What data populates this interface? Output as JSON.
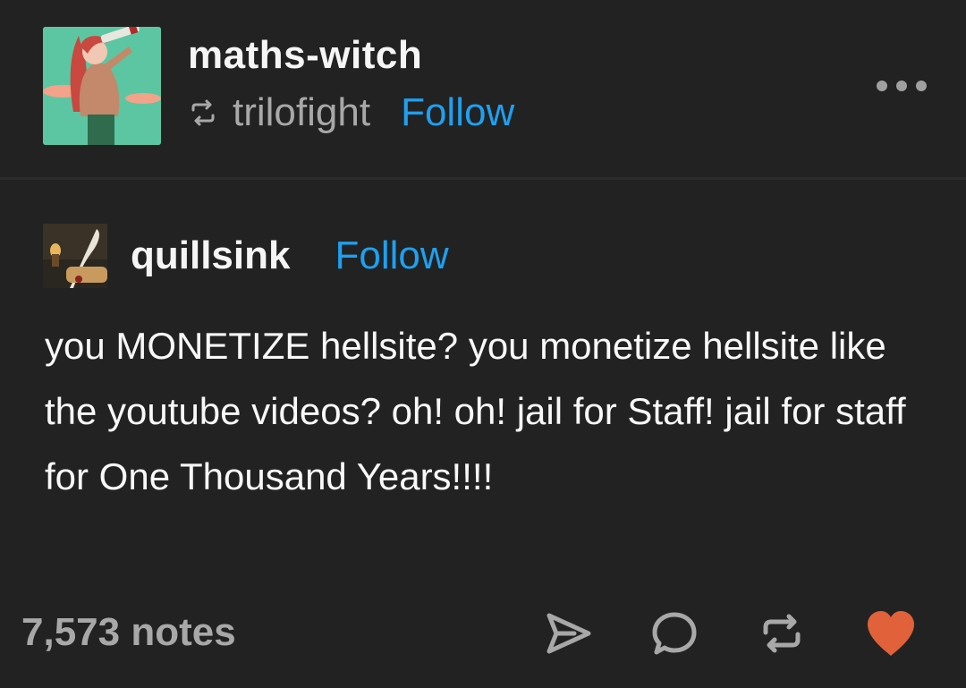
{
  "header": {
    "username": "maths-witch",
    "reblogged_from": "trilofight",
    "follow_label": "Follow",
    "avatar_icon": "illustrated-avatar-icon"
  },
  "quote": {
    "username": "quillsink",
    "follow_label": "Follow",
    "avatar_icon": "quill-avatar-icon",
    "text": "you MONETIZE hellsite? you monetize hellsite like the youtube videos? oh! oh! jail for Staff! jail for staff for One Thousand Years!!!!"
  },
  "footer": {
    "notes": "7,573 notes",
    "actions": [
      "share-icon",
      "reply-icon",
      "reblog-icon",
      "like-icon"
    ]
  },
  "colors": {
    "background": "#222222",
    "link": "#1ea0f0",
    "muted": "#a8a8a8",
    "heart": "#e0613a"
  }
}
